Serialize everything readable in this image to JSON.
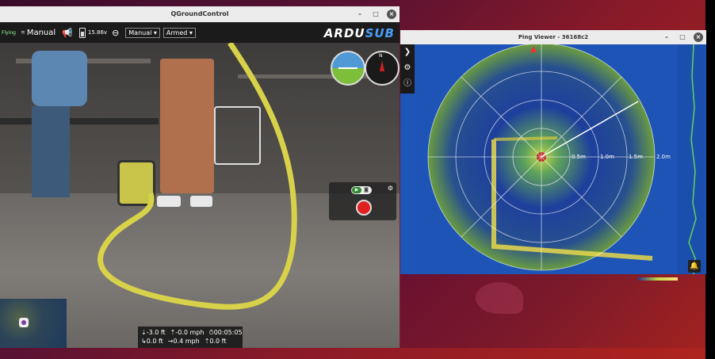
{
  "qgc": {
    "window_title": "QGroundControl",
    "toolbar": {
      "status": "Flying",
      "mode": "Manual",
      "battery_voltage": "15.86v",
      "flight_mode_dropdown": "Manual",
      "arm_dropdown": "Armed",
      "logo_main": "ARDU",
      "logo_sub": "SUB"
    },
    "telemetry": {
      "row1": {
        "depth": "⇣-3.0 ft",
        "vertical_speed": "⇡-0.0 mph",
        "flight_time": "⏱00:05:05"
      },
      "row2": {
        "distance": "↳0.0 ft",
        "horizontal_speed": "→0.4 mph",
        "altitude": "⇡0.0 ft"
      }
    },
    "camera": {
      "video_mode": "video-icon",
      "photo_mode": "camera-icon"
    }
  },
  "ping": {
    "window_title": "Ping Viewer - 36168c2",
    "range_labels": [
      "0.5m",
      "1.0m",
      "1.5m",
      "2.0m"
    ]
  },
  "colors": {
    "sonar_bg": "#1d54b5",
    "record": "#e02020",
    "accent": "#4a9ef6"
  }
}
